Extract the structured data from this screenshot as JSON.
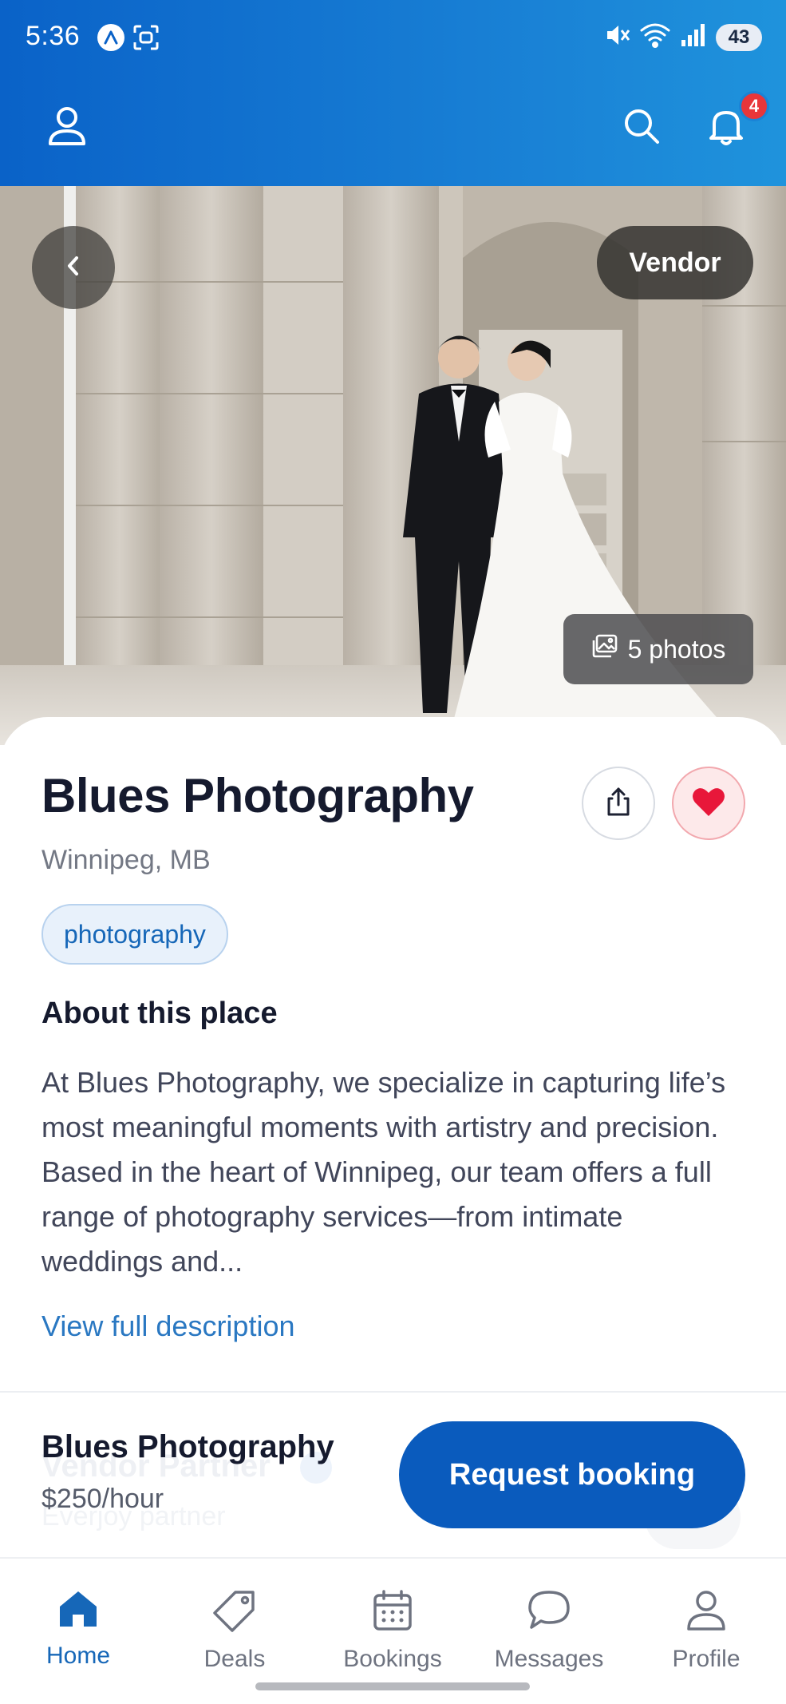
{
  "status_bar": {
    "time": "5:36",
    "battery": "43",
    "icons": [
      "a-circle-icon",
      "screen-record-icon",
      "mute-icon",
      "wifi-icon",
      "signal-icon"
    ]
  },
  "app_bar": {
    "notification_count": "4",
    "icons": [
      "profile-icon",
      "search-icon",
      "bell-icon"
    ]
  },
  "hero": {
    "vendor_label": "Vendor",
    "photos_label": "5 photos"
  },
  "vendor": {
    "name": "Blues Photography",
    "location": "Winnipeg, MB",
    "category": "photography",
    "favorited": true
  },
  "about": {
    "title": "About this place",
    "text": "At Blues Photography, we specialize in capturing life’s most meaningful moments with artistry and precision. Based in the heart of Winnipeg, our team offers a full range of photography services—from intimate weddings and...",
    "view_full": "View full description"
  },
  "booking": {
    "name": "Blues Photography",
    "price": "$250/hour",
    "button": "Request booking",
    "ghost_title": "Vendor Partner",
    "ghost_sub": "Everjoy partner"
  },
  "bottom_nav": {
    "items": [
      {
        "label": "Home",
        "icon": "home-icon",
        "active": true
      },
      {
        "label": "Deals",
        "icon": "tag-icon",
        "active": false
      },
      {
        "label": "Bookings",
        "icon": "calendar-icon",
        "active": false
      },
      {
        "label": "Messages",
        "icon": "chat-icon",
        "active": false
      },
      {
        "label": "Profile",
        "icon": "person-icon",
        "active": false
      }
    ]
  },
  "colors": {
    "header_blue": "#0a62c8",
    "primary_button": "#0a5bbd",
    "link": "#2a78c2",
    "favorite_red": "#e8173a",
    "badge_red": "#e8363a"
  }
}
